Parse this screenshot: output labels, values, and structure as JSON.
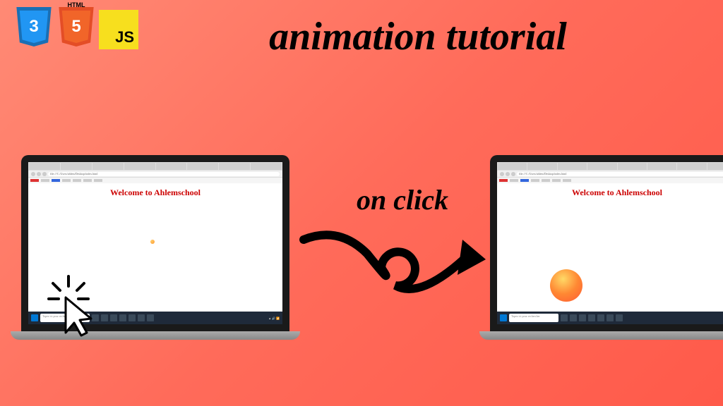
{
  "title": "animation tutorial",
  "arrow_label": "on click",
  "badges": {
    "html_top": "HTML",
    "css_num": "3",
    "html_num": "5",
    "js_label": "JS"
  },
  "browser": {
    "page_heading": "Welcome to Ahlemschool",
    "address": "file:///C:/Users/ahlem/Desktop/index.html",
    "search_placeholder": "Tapez ici pour rechercher"
  }
}
